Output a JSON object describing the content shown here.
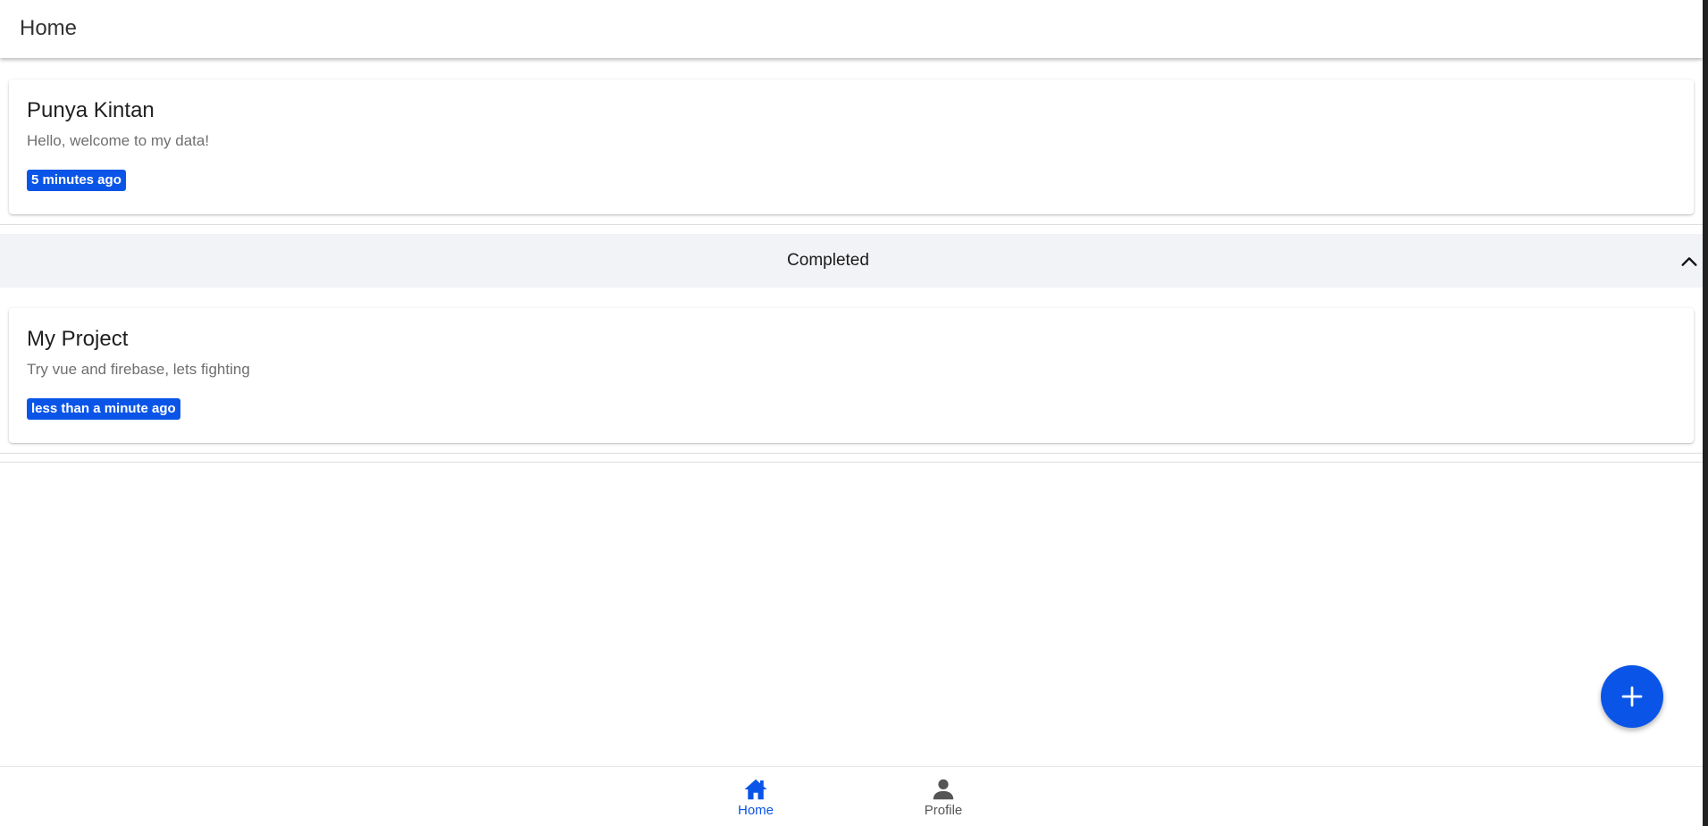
{
  "header": {
    "title": "Home"
  },
  "tasks": [
    {
      "title": "Punya Kintan",
      "description": "Hello, welcome to my data!",
      "time": "5 minutes ago"
    }
  ],
  "completed_section": {
    "label": "Completed",
    "expanded": true,
    "toggle_icon": "chevron-up-icon",
    "items": [
      {
        "title": "My Project",
        "description": "Try vue and firebase, lets fighting",
        "time": "less than a minute ago"
      }
    ]
  },
  "fab": {
    "icon": "plus-icon"
  },
  "bottom_nav": {
    "items": [
      {
        "label": "Home",
        "icon": "home-icon",
        "active": true
      },
      {
        "label": "Profile",
        "icon": "person-icon",
        "active": false
      }
    ]
  },
  "colors": {
    "accent": "#0a55e8",
    "section_bg": "#f2f3f6",
    "muted_text": "#6f6f6f"
  }
}
